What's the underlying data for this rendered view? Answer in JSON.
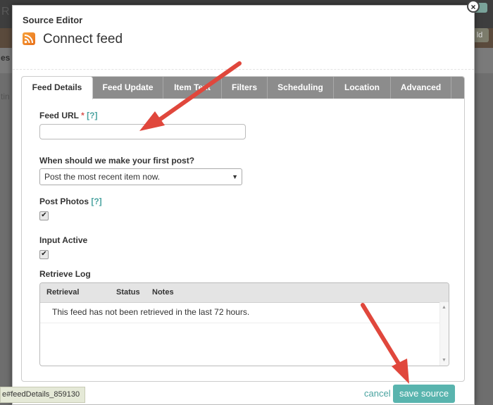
{
  "modal": {
    "label": "Source Editor",
    "title": "Connect feed",
    "close_glyph": "×"
  },
  "tabs": [
    {
      "label": "Feed Details",
      "active": true
    },
    {
      "label": "Feed Update",
      "active": false
    },
    {
      "label": "Item Text",
      "active": false
    },
    {
      "label": "Filters",
      "active": false
    },
    {
      "label": "Scheduling",
      "active": false
    },
    {
      "label": "Location",
      "active": false
    },
    {
      "label": "Advanced",
      "active": false
    }
  ],
  "form": {
    "feed_url_label": "Feed URL",
    "required_mark": "*",
    "help_text": "[?]",
    "feed_url_value": "",
    "first_post_label": "When should we make your first post?",
    "first_post_selected": "Post the most recent item now.",
    "post_photos_label": "Post Photos",
    "post_photos_checked": true,
    "input_active_label": "Input Active",
    "input_active_checked": true,
    "check_glyph": "✔",
    "select_arrow": "▼"
  },
  "retrieve_log": {
    "label": "Retrieve Log",
    "columns": [
      "Retrieval",
      "Status",
      "Notes"
    ],
    "message": "This feed has not been retrieved in the last 72 hours.",
    "scroll_up": "▲",
    "scroll_down": "▼"
  },
  "footer": {
    "cancel_label": "cancel",
    "save_label": "save source"
  },
  "status_bar": {
    "text": "e#feedDetails_859130"
  },
  "background": {
    "frag_1": "es",
    "frag_2": "tin",
    "frag_3": "R",
    "right_btn": "ld"
  },
  "colors": {
    "accent": "#59b4ae",
    "help_link": "#4aa3a0",
    "required": "#d9534f",
    "tab_bar": "#8c8c8c",
    "arrow": "#e0473c",
    "rss": "#f08a2a"
  }
}
